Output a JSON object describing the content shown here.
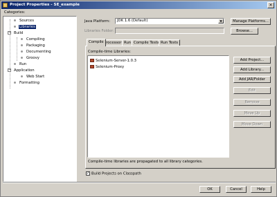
{
  "window": {
    "title": "Project Properties - SE_example"
  },
  "categories_label": "Categories:",
  "tree": {
    "sources": "Sources",
    "libraries": "Libraries",
    "build": "Build",
    "compiling": "Compiling",
    "packaging": "Packaging",
    "documenting": "Documenting",
    "groovy": "Groovy",
    "run": "Run",
    "application": "Application",
    "web_start": "Web Start",
    "formatting": "Formatting"
  },
  "java_platform": {
    "label": "Java Platform:",
    "value": "JDK 1.6 (Default)",
    "manage_button": "Manage Platforms..."
  },
  "libraries_folder": {
    "label": "Libraries Folder:",
    "browse_button": "Browse..."
  },
  "tabs": [
    "Compile",
    "Processor",
    "Run",
    "Compile Tests",
    "Run Tests"
  ],
  "compile": {
    "label": "Compile-time Libraries:",
    "libraries": [
      "Selenium-Server-1.0.3",
      "Selenium-Proxy"
    ],
    "note": "Compile-time libraries are propagated to all library categories."
  },
  "side_buttons": {
    "add_project": "Add Project...",
    "add_library": "Add Library...",
    "add_jar": "Add JAR/Folder",
    "edit": "Edit",
    "remove": "Remove",
    "move_up": "Move Up",
    "move_down": "Move Down"
  },
  "build_on_classpath": {
    "label": "Build Projects on Classpath",
    "checked": true
  },
  "footer": {
    "ok": "OK",
    "cancel": "Cancel",
    "help": "Help"
  }
}
